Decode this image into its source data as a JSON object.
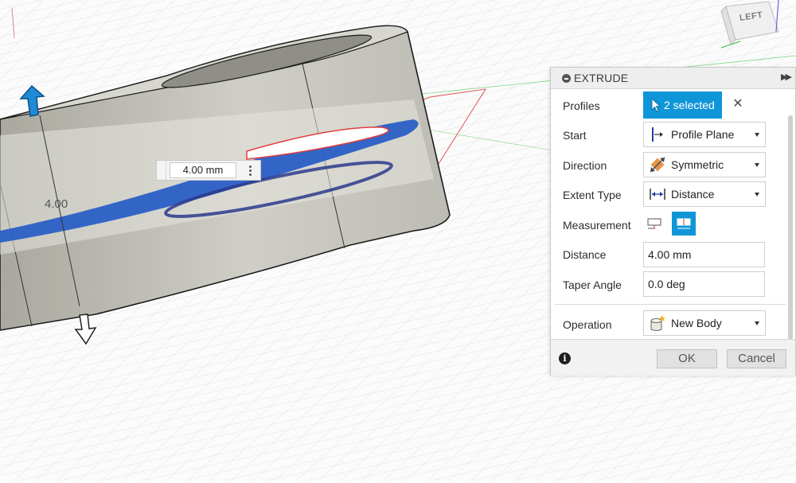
{
  "viewport": {
    "dimension_input_value": "4.00 mm",
    "dimension_text": "4.00",
    "viewcube_face": "LEFT",
    "colors": {
      "body": "#c8c7c0",
      "profile_blue": "#2a5fc6",
      "accent": "#0f96d8",
      "sketch_plane": "#e23b3b"
    }
  },
  "panel": {
    "title": "EXTRUDE",
    "collapse_icon": "minus-circle-icon",
    "expand_icon": "double-chevron-right-icon",
    "profiles": {
      "label": "Profiles",
      "selection": "2 selected",
      "clear_icon": "x-icon"
    },
    "start": {
      "label": "Start",
      "value": "Profile Plane",
      "icon": "profile-plane-icon"
    },
    "direction": {
      "label": "Direction",
      "value": "Symmetric",
      "icon": "symmetric-icon"
    },
    "extent_type": {
      "label": "Extent Type",
      "value": "Distance",
      "icon": "distance-arrows-icon"
    },
    "measurement": {
      "label": "Measurement",
      "options": [
        "half-length-icon",
        "whole-length-icon"
      ],
      "selected_index": 1
    },
    "distance": {
      "label": "Distance",
      "value": "4.00 mm"
    },
    "taper_angle": {
      "label": "Taper Angle",
      "value": "0.0 deg"
    },
    "operation": {
      "label": "Operation",
      "value": "New Body",
      "icon": "new-body-icon"
    },
    "footer": {
      "info_icon": "info-icon",
      "ok_label": "OK",
      "cancel_label": "Cancel"
    }
  }
}
